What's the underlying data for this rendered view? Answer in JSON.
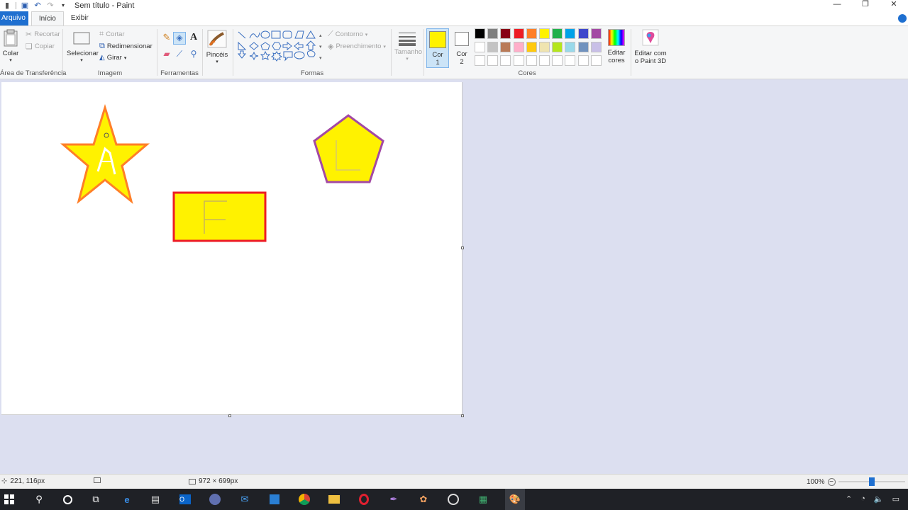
{
  "window": {
    "title": "Sem título - Paint"
  },
  "tabs": [
    {
      "label": "Arquivo"
    },
    {
      "label": "Início"
    },
    {
      "label": "Exibir"
    }
  ],
  "ribbon": {
    "clipboard": {
      "paste_label": "Colar",
      "cut_label": "Recortar",
      "copy_label": "Copiar",
      "group_label": "Área de Transferência"
    },
    "image": {
      "select_label": "Selecionar",
      "crop_label": "Cortar",
      "resize_label": "Redimensionar",
      "rotate_label": "Girar",
      "group_label": "Imagem"
    },
    "tools": {
      "group_label": "Ferramentas",
      "text_tool_glyph": "A"
    },
    "brushes": {
      "label": "Pincéis"
    },
    "shapes": {
      "outline_label": "Contorno",
      "fill_label": "Preenchimento",
      "group_label": "Formas"
    },
    "size": {
      "label": "Tamanho"
    },
    "colors": {
      "color1_label": "Cor 1",
      "color2_label": "Cor 2",
      "color1_value": "#FFF200",
      "color2_value": "#FFFFFF",
      "edit_colors_label": "Editar cores",
      "group_label": "Cores",
      "palette_row1": [
        "#000000",
        "#7F7F7F",
        "#880015",
        "#ED1C24",
        "#FF7F27",
        "#FFF200",
        "#22B14C",
        "#00A2E8",
        "#3F48CC",
        "#A349A4"
      ],
      "palette_row2": [
        "#FFFFFF",
        "#C3C3C3",
        "#B97A57",
        "#FFAEC9",
        "#FFC90E",
        "#EFE4B0",
        "#B5E61D",
        "#99D9EA",
        "#7092BE",
        "#C8BFE7"
      ]
    },
    "paint3d": {
      "label": "Editar com o Paint 3D"
    }
  },
  "canvas": {
    "shapes": [
      {
        "kind": "star",
        "fill": "#FFF200",
        "outline": "#FF7F27",
        "letter": "A"
      },
      {
        "kind": "pentagon",
        "fill": "#FFF200",
        "outline": "#A349A4",
        "letter": "L"
      },
      {
        "kind": "rectangle",
        "fill": "#FFF200",
        "outline": "#ED1C24",
        "letter": "F"
      }
    ]
  },
  "status": {
    "cursor_position": "221, 116px",
    "canvas_size": "972 × 699px",
    "zoom": "100%",
    "zoom_level_fraction": 0.5
  }
}
